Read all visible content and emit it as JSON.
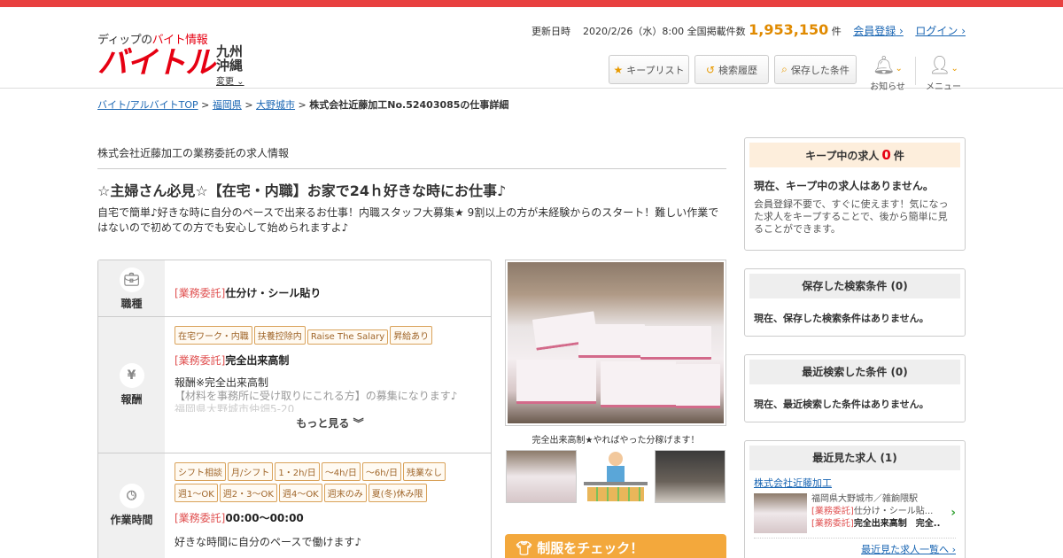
{
  "header": {
    "logo_tagline_prefix": "ディップの",
    "logo_tagline_highlight": "バイト情報",
    "logo_main": "バイトル",
    "region": "九州沖縄",
    "region_change": "変更",
    "updated_label": "更新日時",
    "updated_value": "2020/2/26（水）8:00",
    "listing_label": "全国掲載件数",
    "listing_count": "1,953,150",
    "listing_unit": "件",
    "register_link": "会員登録",
    "login_link": "ログイン",
    "keep_list_button": "キープリスト",
    "search_history_button": "検索履歴",
    "saved_conditions_button": "保存した条件",
    "notifications_label": "お知らせ",
    "menu_label": "メニュー",
    "accent_color": "#e60012"
  },
  "breadcrumb": {
    "home": "バイト/アルバイトTOP",
    "pref": "福岡県",
    "city": "大野城市",
    "current": "株式会社近藤加工No.52403085の仕事詳細"
  },
  "job": {
    "company_line": "株式会社近藤加工の業務委託の求人情報",
    "title": "☆主婦さん必見☆【在宅・内職】お家で24ｈ好きな時にお仕事♪",
    "description": "自宅で簡単♪好きな時に自分のペースで出来るお仕事！内職スタッフ大募集★ 9割以上の方が未経験からのスタート！難しい作業ではないので初めての方でも安心して始められますよ♪",
    "rows": {
      "occupation": {
        "label": "職種",
        "type": "[業務委託]",
        "value": "仕分け・シール貼り"
      },
      "pay": {
        "label": "報酬",
        "tags": [
          "在宅ワーク・内職",
          "扶養控除内",
          "Raise The Salary",
          "昇給あり"
        ],
        "type": "[業務委託]",
        "value": "完全出来高制",
        "detail1": "報酬※完全出来高制",
        "detail2": "【材料を事務所に受け取りにこれる方】の募集になります♪",
        "detail3": "福岡県大野城市仲畑5-20",
        "more": "もっと見る"
      },
      "hours": {
        "label": "作業時間",
        "tags1": [
          "シフト相談",
          "月/シフト",
          "1・2h/日",
          "～4h/日",
          "～6h/日",
          "残業なし"
        ],
        "tags2": [
          "週1〜OK",
          "週2・3〜OK",
          "週4〜OK",
          "週末のみ",
          "夏(冬)休み限"
        ],
        "type": "[業務委託]",
        "value": "00:00～00:00",
        "note": "好きな時間に自分のペースで働けます♪"
      }
    },
    "photo_caption": "完全出来高制★やればやった分稼げます！",
    "uniform_cta": "制服をチェック！"
  },
  "sidebar": {
    "keep": {
      "title": "キープ中の求人",
      "count": "0",
      "unit": "件",
      "empty": "現在、キープ中の求人はありません。",
      "note": "会員登録不要で、すぐに使えます！気になった求人をキープすることで、後から簡単に見ることができます。"
    },
    "saved": {
      "title": "保存した検索条件",
      "count": "(0)",
      "empty": "現在、保存した検索条件はありません。"
    },
    "recent_search": {
      "title": "最近検索した条件",
      "count": "(0)",
      "empty": "現在、最近検索した条件はありません。"
    },
    "recent_viewed": {
      "title": "最近見た求人",
      "count": "(1)",
      "company": "株式会社近藤加工",
      "location": "福岡県大野城市／雑餉隈駅",
      "line1_type": "[業務委託]",
      "line1": "仕分け・シール貼...",
      "line2_type": "[業務委託]",
      "line2": "完全出来高制　完全...",
      "list_link": "最近見た求人一覧へ"
    }
  }
}
